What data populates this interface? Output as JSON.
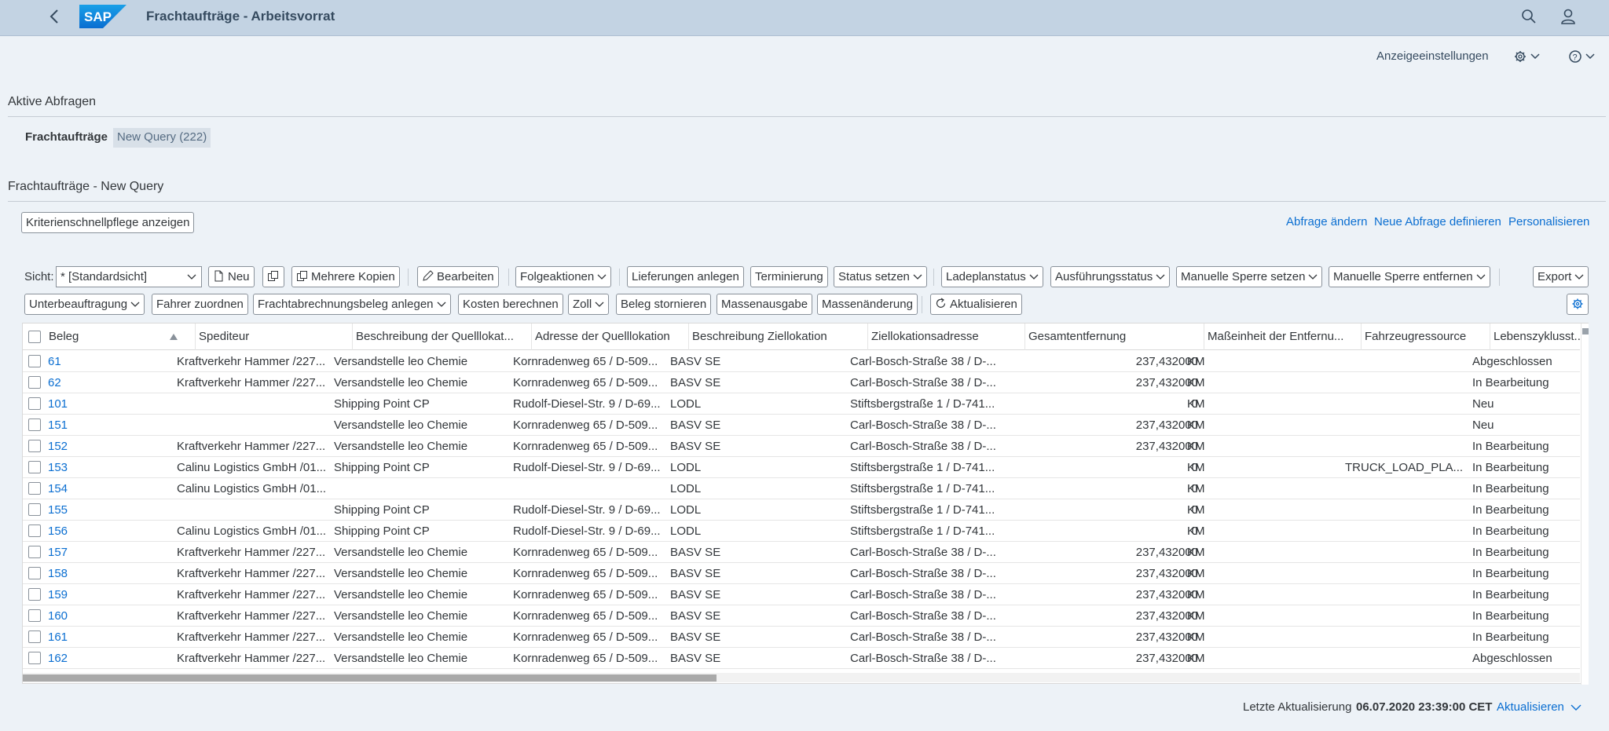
{
  "app": {
    "title": "Frachtaufträge - Arbeitsvorrat",
    "logo_text": "SAP"
  },
  "topbar": {
    "display_settings": "Anzeigeeinstellungen"
  },
  "active_queries": {
    "title": "Aktive Abfragen",
    "label": "Frachtaufträge",
    "chip": "New Query (222)"
  },
  "query_section": {
    "title": "Frachtaufträge - New Query",
    "criteria_button": "Kriterienschnellpflege anzeigen",
    "links": [
      "Abfrage ändern",
      "Neue Abfrage definieren",
      "Personalisieren"
    ]
  },
  "toolbar": {
    "view_label": "Sicht:",
    "view_value": "* [Standardsicht]",
    "row1": {
      "new": "Neu",
      "multiple_copies": "Mehrere Kopien",
      "edit": "Bearbeiten",
      "follow_actions": "Folgeaktionen",
      "create_deliveries": "Lieferungen anlegen",
      "scheduling": "Terminierung",
      "set_status": "Status setzen",
      "loading_plan_status": "Ladeplanstatus",
      "execution_status": "Ausführungsstatus",
      "set_manual_block": "Manuelle Sperre setzen",
      "remove_manual_block": "Manuelle Sperre entfernen",
      "export": "Export"
    },
    "row2": {
      "subcontracting": "Unterbeauftragung",
      "assign_driver": "Fahrer zuordnen",
      "create_freight_settlement": "Frachtabrechnungsbeleg anlegen",
      "calculate_costs": "Kosten berechnen",
      "customs": "Zoll",
      "cancel_document": "Beleg stornieren",
      "mass_output": "Massenausgabe",
      "mass_change": "Massenänderung",
      "refresh": "Aktualisieren"
    }
  },
  "table": {
    "columns": [
      "Beleg",
      "Spediteur",
      "Beschreibung der Quelllokat...",
      "Adresse der Quelllokation",
      "Beschreibung Ziellokation",
      "Ziellokationsadresse",
      "Gesamtentfernung",
      "Maßeinheit der Entfernu...",
      "Fahrzeugressource",
      "Lebenszyklusst..."
    ],
    "rows": [
      {
        "beleg": "61",
        "spediteur": "Kraftverkehr Hammer /227...",
        "quelle": "Versandstelle leo Chemie",
        "quelle_adr": "Kornradenweg 65 / D-509...",
        "ziel": "BASV SE",
        "ziel_adr": "Carl-Bosch-Straße 38 / D-...",
        "entf": "237,432000",
        "einheit": "KM",
        "fzg": "",
        "status": "Abgeschlossen"
      },
      {
        "beleg": "62",
        "spediteur": "Kraftverkehr Hammer /227...",
        "quelle": "Versandstelle leo Chemie",
        "quelle_adr": "Kornradenweg 65 / D-509...",
        "ziel": "BASV SE",
        "ziel_adr": "Carl-Bosch-Straße 38 / D-...",
        "entf": "237,432000",
        "einheit": "KM",
        "fzg": "",
        "status": "In Bearbeitung"
      },
      {
        "beleg": "101",
        "spediteur": "",
        "quelle": "Shipping Point CP",
        "quelle_adr": "Rudolf-Diesel-Str. 9 / D-69...",
        "ziel": "LODL",
        "ziel_adr": "Stiftsbergstraße 1 / D-741...",
        "entf": "0",
        "einheit": "KM",
        "fzg": "",
        "status": "Neu"
      },
      {
        "beleg": "151",
        "spediteur": "",
        "quelle": "Versandstelle leo Chemie",
        "quelle_adr": "Kornradenweg 65 / D-509...",
        "ziel": "BASV SE",
        "ziel_adr": "Carl-Bosch-Straße 38 / D-...",
        "entf": "237,432000",
        "einheit": "KM",
        "fzg": "",
        "status": "Neu"
      },
      {
        "beleg": "152",
        "spediteur": "Kraftverkehr Hammer /227...",
        "quelle": "Versandstelle leo Chemie",
        "quelle_adr": "Kornradenweg 65 / D-509...",
        "ziel": "BASV SE",
        "ziel_adr": "Carl-Bosch-Straße 38 / D-...",
        "entf": "237,432000",
        "einheit": "KM",
        "fzg": "",
        "status": "In Bearbeitung"
      },
      {
        "beleg": "153",
        "spediteur": "Calinu Logistics GmbH /01...",
        "quelle": "Shipping Point CP",
        "quelle_adr": "Rudolf-Diesel-Str. 9 / D-69...",
        "ziel": "LODL",
        "ziel_adr": "Stiftsbergstraße 1 / D-741...",
        "entf": "0",
        "einheit": "KM",
        "fzg": "TRUCK_LOAD_PLA...",
        "status": "In Bearbeitung"
      },
      {
        "beleg": "154",
        "spediteur": "Calinu Logistics GmbH /01...",
        "quelle": "",
        "quelle_adr": "",
        "ziel": "LODL",
        "ziel_adr": "Stiftsbergstraße 1 / D-741...",
        "entf": "0",
        "einheit": "KM",
        "fzg": "",
        "status": "In Bearbeitung"
      },
      {
        "beleg": "155",
        "spediteur": "",
        "quelle": "Shipping Point CP",
        "quelle_adr": "Rudolf-Diesel-Str. 9 / D-69...",
        "ziel": "LODL",
        "ziel_adr": "Stiftsbergstraße 1 / D-741...",
        "entf": "0",
        "einheit": "KM",
        "fzg": "",
        "status": "In Bearbeitung"
      },
      {
        "beleg": "156",
        "spediteur": "Calinu Logistics GmbH /01...",
        "quelle": "Shipping Point CP",
        "quelle_adr": "Rudolf-Diesel-Str. 9 / D-69...",
        "ziel": "LODL",
        "ziel_adr": "Stiftsbergstraße 1 / D-741...",
        "entf": "0",
        "einheit": "KM",
        "fzg": "",
        "status": "In Bearbeitung"
      },
      {
        "beleg": "157",
        "spediteur": "Kraftverkehr Hammer /227...",
        "quelle": "Versandstelle leo Chemie",
        "quelle_adr": "Kornradenweg 65 / D-509...",
        "ziel": "BASV SE",
        "ziel_adr": "Carl-Bosch-Straße 38 / D-...",
        "entf": "237,432000",
        "einheit": "KM",
        "fzg": "",
        "status": "In Bearbeitung"
      },
      {
        "beleg": "158",
        "spediteur": "Kraftverkehr Hammer /227...",
        "quelle": "Versandstelle leo Chemie",
        "quelle_adr": "Kornradenweg 65 / D-509...",
        "ziel": "BASV SE",
        "ziel_adr": "Carl-Bosch-Straße 38 / D-...",
        "entf": "237,432000",
        "einheit": "KM",
        "fzg": "",
        "status": "In Bearbeitung"
      },
      {
        "beleg": "159",
        "spediteur": "Kraftverkehr Hammer /227...",
        "quelle": "Versandstelle leo Chemie",
        "quelle_adr": "Kornradenweg 65 / D-509...",
        "ziel": "BASV SE",
        "ziel_adr": "Carl-Bosch-Straße 38 / D-...",
        "entf": "237,432000",
        "einheit": "KM",
        "fzg": "",
        "status": "In Bearbeitung"
      },
      {
        "beleg": "160",
        "spediteur": "Kraftverkehr Hammer /227...",
        "quelle": "Versandstelle leo Chemie",
        "quelle_adr": "Kornradenweg 65 / D-509...",
        "ziel": "BASV SE",
        "ziel_adr": "Carl-Bosch-Straße 38 / D-...",
        "entf": "237,432000",
        "einheit": "KM",
        "fzg": "",
        "status": "In Bearbeitung"
      },
      {
        "beleg": "161",
        "spediteur": "Kraftverkehr Hammer /227...",
        "quelle": "Versandstelle leo Chemie",
        "quelle_adr": "Kornradenweg 65 / D-509...",
        "ziel": "BASV SE",
        "ziel_adr": "Carl-Bosch-Straße 38 / D-...",
        "entf": "237,432000",
        "einheit": "KM",
        "fzg": "",
        "status": "In Bearbeitung"
      },
      {
        "beleg": "162",
        "spediteur": "Kraftverkehr Hammer /227...",
        "quelle": "Versandstelle leo Chemie",
        "quelle_adr": "Kornradenweg 65 / D-509...",
        "ziel": "BASV SE",
        "ziel_adr": "Carl-Bosch-Straße 38 / D-...",
        "entf": "237,432000",
        "einheit": "KM",
        "fzg": "",
        "status": "Abgeschlossen"
      }
    ]
  },
  "footer": {
    "last_update_label": "Letzte Aktualisierung",
    "last_update_value": "06.07.2020 23:39:00 CET",
    "refresh_link": "Aktualisieren"
  },
  "colors": {
    "shell": "#c3d3e3",
    "background": "#edf2f7",
    "link": "#0a6ed1",
    "brand": "#0a6ed1"
  },
  "icons": [
    "back-icon",
    "sap-logo",
    "search-icon",
    "user-icon",
    "gear-icon",
    "help-icon",
    "chevron-down-icon",
    "new-document-icon",
    "copy-icon",
    "multi-copy-icon",
    "edit-icon",
    "refresh-icon",
    "table-settings-icon",
    "sort-ascending-icon"
  ]
}
